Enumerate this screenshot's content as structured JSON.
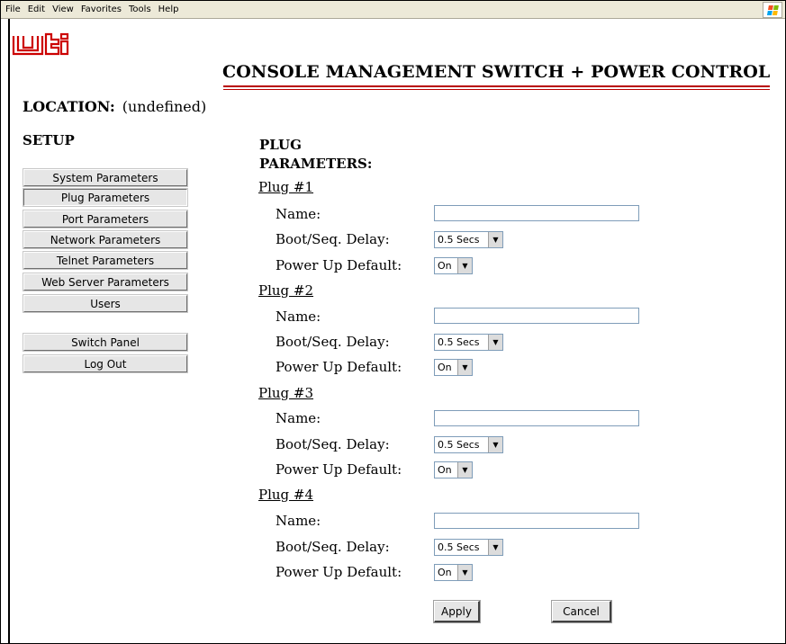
{
  "menubar": {
    "items": [
      "File",
      "Edit",
      "View",
      "Favorites",
      "Tools",
      "Help"
    ]
  },
  "header": {
    "logo_text": "wti",
    "title": "CONSOLE MANAGEMENT SWITCH + POWER CONTROL",
    "location_label": "LOCATION:",
    "location_value": "(undefined)",
    "accent_color": "#b80000"
  },
  "sidebar": {
    "heading": "SETUP",
    "items": [
      {
        "label": "System Parameters"
      },
      {
        "label": "Plug Parameters",
        "active": true
      },
      {
        "label": "Port Parameters"
      },
      {
        "label": "Network Parameters"
      },
      {
        "label": "Telnet Parameters"
      },
      {
        "label": "Web Server Parameters"
      },
      {
        "label": "Users"
      }
    ],
    "bottom_items": [
      {
        "label": "Switch Panel"
      },
      {
        "label": "Log Out"
      }
    ]
  },
  "main": {
    "heading_line1": "PLUG",
    "heading_line2": "PARAMETERS:",
    "name_label": "Name:",
    "delay_label": "Boot/Seq. Delay:",
    "power_label": "Power Up Default:",
    "plugs": [
      {
        "title": "Plug #1",
        "name": "",
        "delay": "0.5 Secs",
        "power_default": "On"
      },
      {
        "title": "Plug #2",
        "name": "",
        "delay": "0.5 Secs",
        "power_default": "On"
      },
      {
        "title": "Plug #3",
        "name": "",
        "delay": "0.5 Secs",
        "power_default": "On"
      },
      {
        "title": "Plug #4",
        "name": "",
        "delay": "0.5 Secs",
        "power_default": "On"
      }
    ],
    "apply_label": "Apply",
    "cancel_label": "Cancel"
  }
}
